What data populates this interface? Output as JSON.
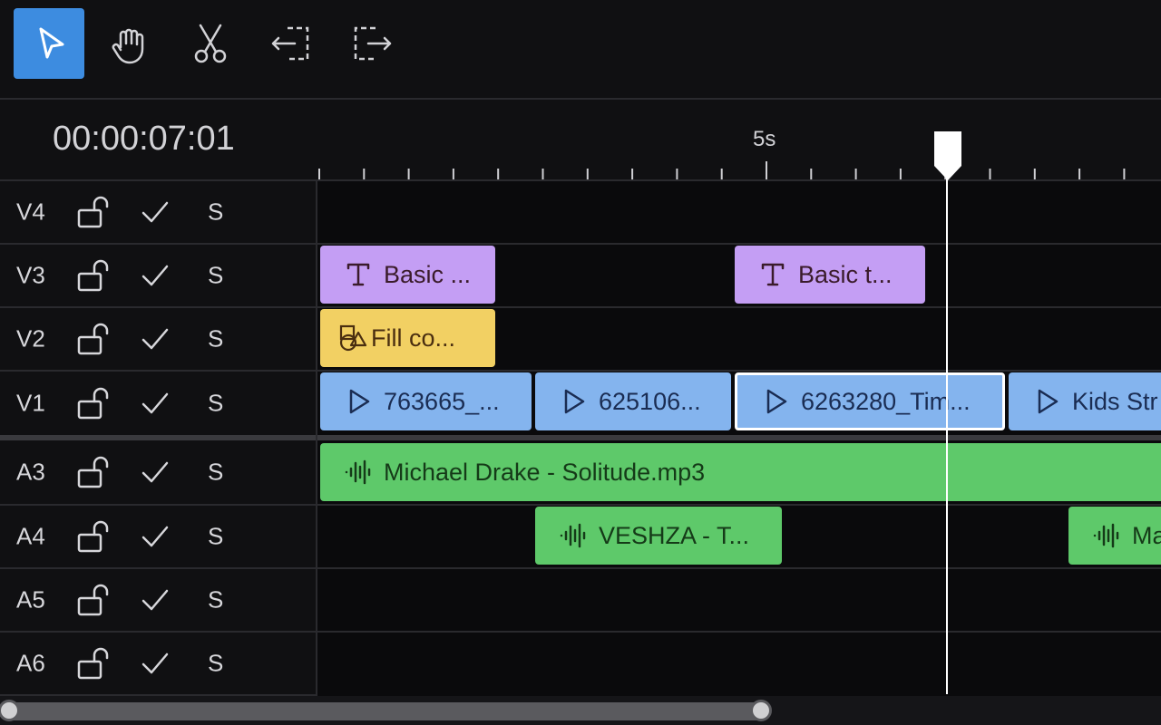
{
  "toolbar": {
    "tools": [
      {
        "name": "select",
        "icon": "pointer-icon",
        "active": true
      },
      {
        "name": "hand",
        "icon": "hand-icon",
        "active": false
      },
      {
        "name": "cut",
        "icon": "scissors-icon",
        "active": false
      },
      {
        "name": "trim-left",
        "icon": "trim-left-icon",
        "active": false
      },
      {
        "name": "trim-right",
        "icon": "trim-right-icon",
        "active": false
      }
    ]
  },
  "timeline": {
    "timecode": "00:00:07:01",
    "ruler_label": "5s"
  },
  "tracks": [
    {
      "id": "V4",
      "solo": "S",
      "kind": "video"
    },
    {
      "id": "V3",
      "solo": "S",
      "kind": "video"
    },
    {
      "id": "V2",
      "solo": "S",
      "kind": "video"
    },
    {
      "id": "V1",
      "solo": "S",
      "kind": "video"
    },
    {
      "id": "A3",
      "solo": "S",
      "kind": "audio"
    },
    {
      "id": "A4",
      "solo": "S",
      "kind": "audio"
    },
    {
      "id": "A5",
      "solo": "S",
      "kind": "audio"
    },
    {
      "id": "A6",
      "solo": "S",
      "kind": "audio"
    }
  ],
  "clips": [
    {
      "track": "V3",
      "type": "text",
      "label": "Basic ..."
    },
    {
      "track": "V3",
      "type": "text",
      "label": "Basic t..."
    },
    {
      "track": "V2",
      "type": "shape",
      "label": "Fill co..."
    },
    {
      "track": "V1",
      "type": "video",
      "label": "763665_..."
    },
    {
      "track": "V1",
      "type": "video",
      "label": "625106..."
    },
    {
      "track": "V1",
      "type": "video",
      "label": "6263280_Tim...",
      "selected": true
    },
    {
      "track": "V1",
      "type": "video",
      "label": "Kids Str"
    },
    {
      "track": "A3",
      "type": "audio",
      "label": "Michael Drake - Solitude.mp3"
    },
    {
      "track": "A4",
      "type": "audio",
      "label": "VESHZA - T..."
    },
    {
      "track": "A4",
      "type": "audio",
      "label": "Ma"
    }
  ],
  "colors": {
    "accent": "#3d8ce0",
    "text_clip": "#c49ef4",
    "shape_clip": "#f2d063",
    "video_clip": "#84b4ee",
    "audio_clip": "#5ec96a"
  }
}
